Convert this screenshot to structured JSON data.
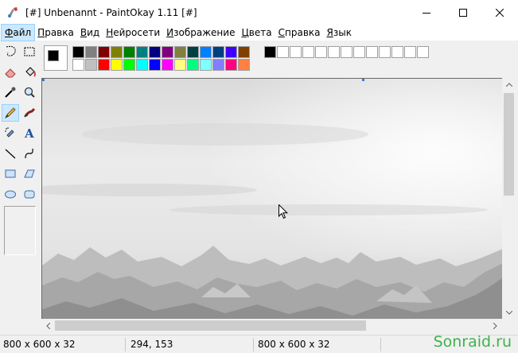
{
  "window": {
    "title": "[#] Unbenannt - PaintOkay 1.11 [#]",
    "minimize_icon": "minimize-icon",
    "maximize_icon": "maximize-icon",
    "close_icon": "close-icon"
  },
  "menu": {
    "items": [
      {
        "label": "Файл",
        "acc": "Ф",
        "rest": "айл"
      },
      {
        "label": "Правка",
        "acc": "П",
        "rest": "равка"
      },
      {
        "label": "Вид",
        "acc": "В",
        "rest": "ид"
      },
      {
        "label": "Нейросети",
        "acc": "Н",
        "rest": "ейросети"
      },
      {
        "label": "Изображение",
        "acc": "И",
        "rest": "зображение"
      },
      {
        "label": "Цвета",
        "acc": "Ц",
        "rest": "вета"
      },
      {
        "label": "Справка",
        "acc": "С",
        "rest": "правка"
      },
      {
        "label": "Язык",
        "acc": "Я",
        "rest": "зык"
      }
    ]
  },
  "tools": [
    {
      "name": "free-select-icon"
    },
    {
      "name": "rect-select-icon"
    },
    {
      "name": "eraser-icon"
    },
    {
      "name": "fill-bucket-icon"
    },
    {
      "name": "color-picker-icon"
    },
    {
      "name": "magnifier-icon"
    },
    {
      "name": "pencil-icon"
    },
    {
      "name": "brush-icon"
    },
    {
      "name": "airbrush-icon"
    },
    {
      "name": "text-icon"
    },
    {
      "name": "line-icon"
    },
    {
      "name": "curve-icon"
    },
    {
      "name": "rectangle-icon"
    },
    {
      "name": "polygon-icon"
    },
    {
      "name": "ellipse-icon"
    },
    {
      "name": "rounded-rect-icon"
    }
  ],
  "colors": {
    "foreground": "#000000",
    "background": "#ffffff",
    "palette_row1": [
      "#000000",
      "#808080",
      "#800000",
      "#808000",
      "#008000",
      "#008080",
      "#000080",
      "#800080",
      "#808040",
      "#004040",
      "#0080ff",
      "#004080",
      "#4000ff",
      "#804000"
    ],
    "palette_row2": [
      "#ffffff",
      "#c0c0c0",
      "#ff0000",
      "#ffff00",
      "#00ff00",
      "#00ffff",
      "#0000ff",
      "#ff00ff",
      "#ffff80",
      "#00ff80",
      "#80ffff",
      "#8080ff",
      "#ff0080",
      "#ff8040"
    ],
    "custom_row1": [
      "#000000",
      "#ffffff",
      "#ffffff",
      "#ffffff",
      "#ffffff",
      "#ffffff",
      "#ffffff",
      "#ffffff",
      "#ffffff",
      "#ffffff",
      "#ffffff",
      "#ffffff",
      "#ffffff"
    ],
    "custom_row2": [
      "#ffffff",
      "#ffffff",
      "#ffffff",
      "#ffffff",
      "#ffffff",
      "#ffffff",
      "#ffffff",
      "#ffffff",
      "#ffffff",
      "#ffffff",
      "#ffffff",
      "#ffffff",
      "#ffffff"
    ]
  },
  "status": {
    "image_size": "800 x 600 x 32",
    "cursor_pos": "294, 153",
    "image_size_2": "800 x 600 x 32"
  },
  "watermark": "Sonraid.ru"
}
